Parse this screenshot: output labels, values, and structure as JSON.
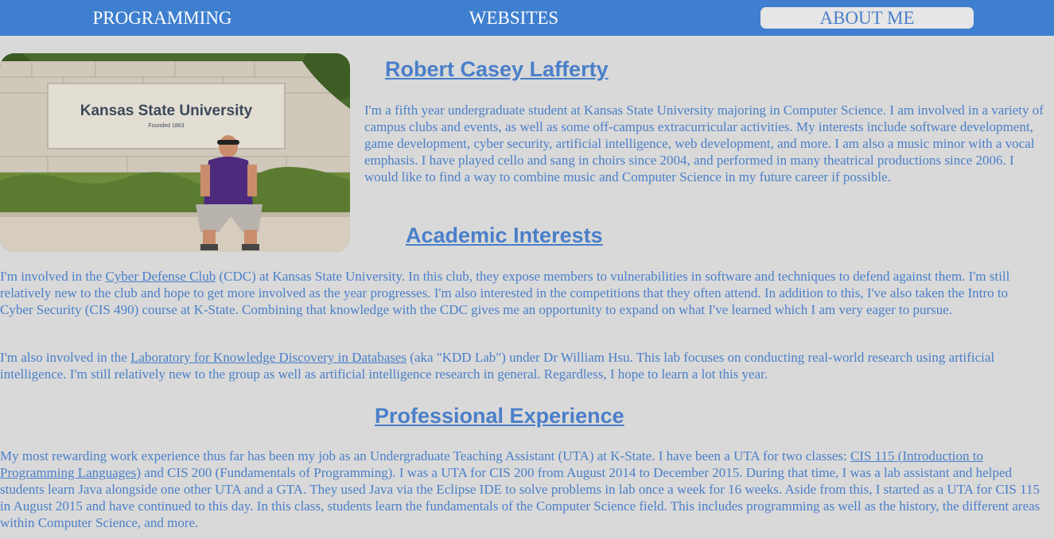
{
  "nav": {
    "items": [
      {
        "label": "PROGRAMMING"
      },
      {
        "label": "WEBSITES"
      },
      {
        "label": "ABOUT ME"
      }
    ]
  },
  "photo": {
    "sign_text": "Kansas State University",
    "sign_subtext": "Founded 1863"
  },
  "about": {
    "name": "Robert Casey Lafferty",
    "intro": "I'm a fifth year undergraduate student at Kansas State University majoring in Computer Science. I am involved in a variety of campus clubs and events, as well as some off-campus extracurricular activities. My interests include software development, game development, cyber security, artificial intelligence, web development, and more. I am also a music minor with a vocal emphasis. I have played cello and sang in choirs since 2004, and performed in many theatrical productions since 2006. I would like to find a way to combine music and Computer Science in my future career if possible."
  },
  "academic": {
    "heading": "Academic Interests",
    "cdc_pre": "I'm involved in the ",
    "cdc_link": "Cyber Defense Club",
    "cdc_post": " (CDC) at Kansas State University. In this club, they expose members to vulnerabilities in software and techniques to defend against them. I'm still relatively new to the club and hope to get more involved as the year progresses. I'm also interested in the competitions that they often attend. In addition to this, I've also taken the Intro to Cyber Security (CIS 490) course at K-State. Combining that knowledge with the CDC gives me an opportunity to expand on what I've learned which I am very eager to pursue.",
    "kdd_pre": "I'm also involved in the ",
    "kdd_link": "Laboratory for Knowledge Discovery in Databases",
    "kdd_post": " (aka \"KDD Lab\") under Dr William Hsu. This lab focuses on conducting real-world research using artificial intelligence. I'm still relatively new to the group as well as artificial intelligence research in general. Regardless, I hope to learn a lot this year."
  },
  "professional": {
    "heading": "Professional Experience",
    "pre": "My most rewarding work experience thus far has been my job as an Undergraduate Teaching Assistant (UTA) at K-State. I have been a UTA for two classes: ",
    "link": "CIS 115 (Introduction to Programming Languages)",
    "post": " and CIS 200 (Fundamentals of Programming). I was a UTA for CIS 200 from August 2014 to December 2015. During that time, I was a lab assistant and helped students learn Java alongside one other UTA and a GTA. They used Java via the Eclipse IDE to solve problems in lab once a week for 16 weeks. Aside from this, I started as a UTA for CIS 115 in August 2015 and have continued to this day. In this class, students learn the fundamentals of the Computer Science field. This includes programming as well as the history, the different areas within Computer Science, and more."
  },
  "colors": {
    "nav_bg": "#3f7fcf",
    "page_bg": "#d9d9d9",
    "text": "#4a7fc9",
    "active_tab_bg": "#e6e6e6"
  }
}
